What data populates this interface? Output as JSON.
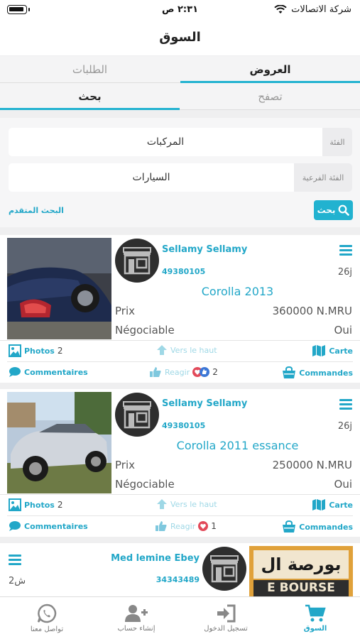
{
  "status": {
    "carrier": "شركة الاتصالات",
    "time": "٢:٣١ ص"
  },
  "header": {
    "title": "السوق"
  },
  "tabs": {
    "offers": "العروض",
    "requests": "الطلبات",
    "search": "بحث",
    "browse": "تصفح"
  },
  "search": {
    "category_label": "الفئة",
    "category_value": "المركبات",
    "subcategory_label": "الفئة الفرعية",
    "subcategory_value": "السيارات",
    "advanced": "البحث المتقدم",
    "button": "بحث"
  },
  "listings": [
    {
      "user": "Sellamy Sellamy",
      "phone": "49380105",
      "age": "26j",
      "title": "Corolla 2013",
      "price_label": "Prix",
      "price": "360000 N.MRU",
      "negotiable_label": "Négociable",
      "negotiable": "Oui",
      "photos_label": "Photos",
      "photos_count": "2",
      "up_label": "Vers le haut",
      "map_label": "Carte",
      "comments_label": "Commentaires",
      "react_label": "Reagir",
      "react_count": "2",
      "orders_label": "Commandes"
    },
    {
      "user": "Sellamy Sellamy",
      "phone": "49380105",
      "age": "26j",
      "title": "Corolla 2011 essance",
      "price_label": "Prix",
      "price": "250000 N.MRU",
      "negotiable_label": "Négociable",
      "negotiable": "Oui",
      "photos_label": "Photos",
      "photos_count": "2",
      "up_label": "Vers le haut",
      "map_label": "Carte",
      "comments_label": "Commentaires",
      "react_label": "Reagir",
      "react_count": "1",
      "orders_label": "Commandes"
    },
    {
      "user": "Mеd lemine Ebey",
      "phone": "34343489",
      "age": "2ش",
      "sign_text_1": "بورصة ال",
      "sign_text_2": "E BOURSE"
    }
  ],
  "bottom_nav": {
    "market": "السوق",
    "login": "تسجيل الدخول",
    "create": "إنشاء حساب",
    "contact": "تواصل معنا"
  },
  "colors": {
    "accent": "#22b2d0",
    "link": "#22a7c8"
  }
}
